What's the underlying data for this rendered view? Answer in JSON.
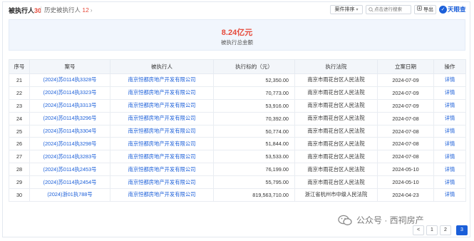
{
  "header": {
    "tab_main_label": "被执行人",
    "tab_main_count": "30",
    "tab_history_label": "历史被执行人",
    "tab_history_count": "12",
    "sort_label": "案件排序",
    "search_placeholder": "点击进行搜索",
    "export_label": "导出",
    "brand": "天眼查"
  },
  "summary": {
    "amount": "8.24亿元",
    "label": "被执行总金额"
  },
  "table": {
    "columns": [
      "序号",
      "案号",
      "被执行人",
      "执行标的（元）",
      "执行法院",
      "立案日期",
      "操作"
    ],
    "rows": [
      {
        "no": "21",
        "case": "(2024)苏0114执3328号",
        "party": "南京恒都房地产开发有限公司",
        "amount": "52,350.00",
        "court": "南京市雨花台区人民法院",
        "date": "2024-07-09",
        "action": "详情"
      },
      {
        "no": "22",
        "case": "(2024)苏0114执3323号",
        "party": "南京恒都房地产开发有限公司",
        "amount": "70,773.00",
        "court": "南京市雨花台区人民法院",
        "date": "2024-07-09",
        "action": "详情"
      },
      {
        "no": "23",
        "case": "(2024)苏0114执3313号",
        "party": "南京恒都房地产开发有限公司",
        "amount": "53,916.00",
        "court": "南京市雨花台区人民法院",
        "date": "2024-07-09",
        "action": "详情"
      },
      {
        "no": "24",
        "case": "(2024)苏0114执3296号",
        "party": "南京恒都房地产开发有限公司",
        "amount": "70,392.00",
        "court": "南京市雨花台区人民法院",
        "date": "2024-07-08",
        "action": "详情"
      },
      {
        "no": "25",
        "case": "(2024)苏0114执3304号",
        "party": "南京恒都房地产开发有限公司",
        "amount": "50,774.00",
        "court": "南京市雨花台区人民法院",
        "date": "2024-07-08",
        "action": "详情"
      },
      {
        "no": "26",
        "case": "(2024)苏0114执3298号",
        "party": "南京恒都房地产开发有限公司",
        "amount": "51,844.00",
        "court": "南京市雨花台区人民法院",
        "date": "2024-07-08",
        "action": "详情"
      },
      {
        "no": "27",
        "case": "(2024)苏0114执3283号",
        "party": "南京恒都房地产开发有限公司",
        "amount": "53,533.00",
        "court": "南京市雨花台区人民法院",
        "date": "2024-07-08",
        "action": "详情"
      },
      {
        "no": "28",
        "case": "(2024)苏0114执2453号",
        "party": "南京恒都房地产开发有限公司",
        "amount": "76,199.00",
        "court": "南京市雨花台区人民法院",
        "date": "2024-05-10",
        "action": "详情"
      },
      {
        "no": "29",
        "case": "(2024)苏0114执2454号",
        "party": "南京恒都房地产开发有限公司",
        "amount": "55,795.00",
        "court": "南京市雨花台区人民法院",
        "date": "2024-05-10",
        "action": "详情"
      },
      {
        "no": "30",
        "case": "(2024)浙01执788号",
        "party": "南京恒都房地产开发有限公司",
        "amount": "819,563,710.00",
        "court": "浙江省杭州市中级人民法院",
        "date": "2024-04-23",
        "action": "详情"
      }
    ]
  },
  "pagination": {
    "prev": "<",
    "pages": [
      "1",
      "2",
      "3"
    ],
    "current": "3"
  },
  "watermark": "公众号 · 西祠房产",
  "colors": {
    "accent": "#1b5fd9",
    "highlight": "#e64a3b",
    "summary_bg": "#f1f6fd",
    "header_bg": "#f3f6fa"
  }
}
